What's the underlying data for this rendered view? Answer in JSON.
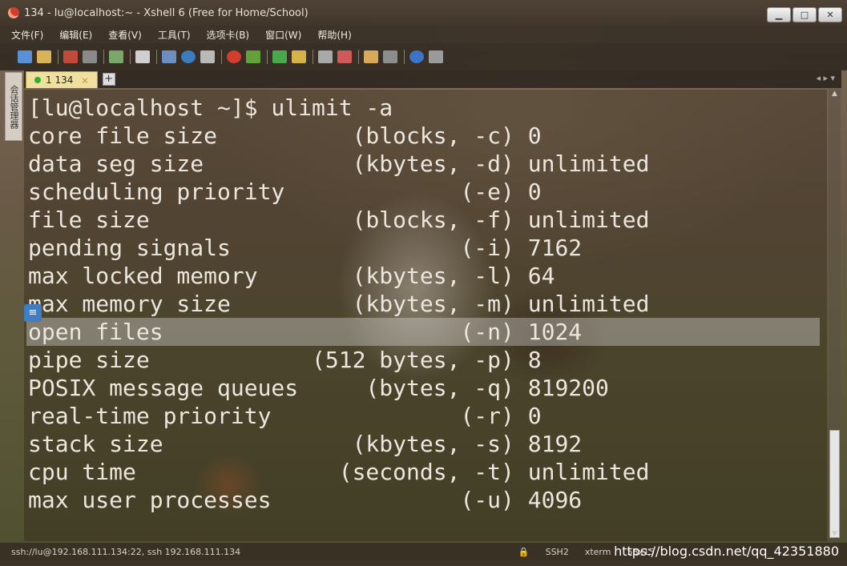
{
  "window": {
    "title": "134 - lu@localhost:~ - Xshell 6 (Free for Home/School)",
    "controls": {
      "minimize": "▁",
      "maximize": "□",
      "close": "✕"
    }
  },
  "menu": [
    "文件(F)",
    "编辑(E)",
    "查看(V)",
    "工具(T)",
    "选项卡(B)",
    "窗口(W)",
    "帮助(H)"
  ],
  "sidepanel_label": "会话管理器",
  "tab": {
    "label": "1 134",
    "close": "×",
    "add": "+"
  },
  "terminal": {
    "prompt_line": "[lu@localhost ~]$ ulimit -a",
    "lines": [
      "core file size          (blocks, -c) 0",
      "data seg size           (kbytes, -d) unlimited",
      "scheduling priority             (-e) 0",
      "file size               (blocks, -f) unlimited",
      "pending signals                 (-i) 7162",
      "max locked memory       (kbytes, -l) 64",
      "max memory size         (kbytes, -m) unlimited",
      "open files                      (-n) 1024",
      "pipe size            (512 bytes, -p) 8",
      "POSIX message queues     (bytes, -q) 819200",
      "real-time priority              (-r) 0",
      "stack size              (kbytes, -s) 8192",
      "cpu time               (seconds, -t) unlimited",
      "max user processes              (-u) 4096"
    ],
    "highlighted_line": "open files"
  },
  "status": {
    "connection": "ssh://lu@192.168.111.134:22, ssh 192.168.111.134",
    "protocol": "SSH2",
    "terminal_type": "xterm",
    "size": "58x15"
  },
  "watermark": "https://blog.csdn.net/qq_42351880",
  "colors": {
    "terminal_text": "#ece7de",
    "tab_bg": "#f0e0a0",
    "online_dot": "#2db12d"
  }
}
